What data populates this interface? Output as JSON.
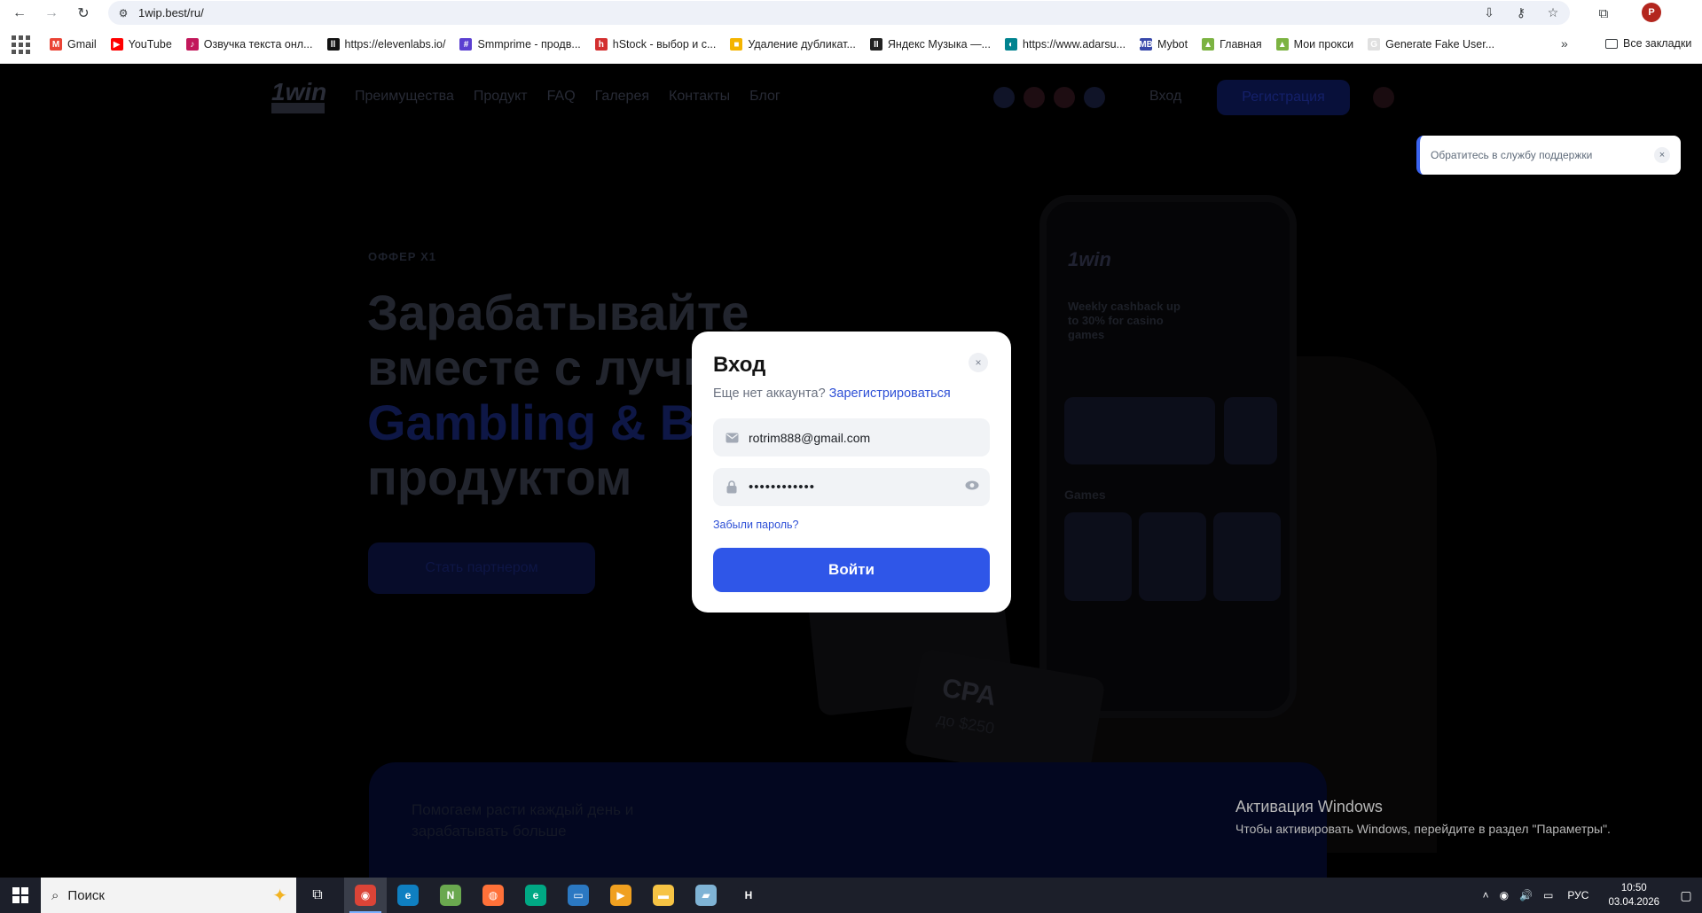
{
  "browser": {
    "url": "1wip.best/ru/",
    "profile_initial": "P",
    "bookmarks": [
      {
        "label": "Gmail",
        "color": "#ea4335",
        "glyph": "M"
      },
      {
        "label": "YouTube",
        "color": "#ff0000",
        "glyph": "▶"
      },
      {
        "label": "Озвучка текста онл...",
        "color": "#c2185b",
        "glyph": "♪"
      },
      {
        "label": "https://elevenlabs.io/",
        "color": "#111111",
        "glyph": "ll"
      },
      {
        "label": "Smmprime - продв...",
        "color": "#5b3fd1",
        "glyph": "#"
      },
      {
        "label": "hStock - выбор и с...",
        "color": "#d32f2f",
        "glyph": "h"
      },
      {
        "label": "Удаление дубликат...",
        "color": "#f4b400",
        "glyph": "■"
      },
      {
        "label": "Яндекс Музыка —...",
        "color": "#222222",
        "glyph": "II"
      },
      {
        "label": "https://www.adarsu...",
        "color": "#00838f",
        "glyph": "◐"
      },
      {
        "label": "Mybot",
        "color": "#3949ab",
        "glyph": "MB"
      },
      {
        "label": "Главная",
        "color": "#7cb342",
        "glyph": "▲"
      },
      {
        "label": "Мои прокси",
        "color": "#7cb342",
        "glyph": "▲"
      },
      {
        "label": "Generate Fake User...",
        "color": "#e0e0e0",
        "glyph": "G"
      }
    ],
    "more_bookmarks": "»",
    "all_bookmarks": "Все закладки"
  },
  "site": {
    "logo": "1win",
    "nav": [
      "Преимущества",
      "Продукт",
      "FAQ",
      "Галерея",
      "Контакты",
      "Блог"
    ],
    "login": "Вход",
    "register": "Регистрация",
    "hero_tag": "ОФФЕР X1",
    "hero_line1": "Зарабатывайте",
    "hero_line2": "вместе с лучш",
    "hero_line3": "Gambling & Be",
    "hero_line4": "продуктом",
    "hero_button": "Стать партнером",
    "phone_logo": "1win",
    "phone_promo": "Weekly cashback up to 30% for casino games",
    "phone_games": "Games",
    "cpa_title": "CPA",
    "cpa_sub": "до $250",
    "bottom_text": "Помогаем расти каждый день и зарабатывать больше"
  },
  "toast": {
    "text": "Обратитесь в службу поддержки",
    "close": "×"
  },
  "modal": {
    "title": "Вход",
    "close": "×",
    "no_account": "Еще нет аккаунта?",
    "register_link": "Зарегистрироваться",
    "email_value": "rotrim888@gmail.com",
    "password_value": "••••••••••••",
    "forgot": "Забыли пароль?",
    "submit": "Войти"
  },
  "watermark": {
    "title": "Активация Windows",
    "text": "Чтобы активировать Windows, перейдите в раздел \"Параметры\"."
  },
  "taskbar": {
    "search_placeholder": "Поиск",
    "lang": "РУС",
    "time": "10:50",
    "date": "03.04.2026",
    "apps": [
      {
        "name": "chrome",
        "color": "#db4437",
        "glyph": "◉",
        "active": true
      },
      {
        "name": "edge",
        "color": "#0f7fc1",
        "glyph": "e",
        "active": false
      },
      {
        "name": "notepad-plus",
        "color": "#6aa84f",
        "glyph": "N",
        "active": false
      },
      {
        "name": "firefox",
        "color": "#ff7139",
        "glyph": "◍",
        "active": false
      },
      {
        "name": "app-e",
        "color": "#00a884",
        "glyph": "e",
        "active": false
      },
      {
        "name": "remote-desktop",
        "color": "#2b78c2",
        "glyph": "▭",
        "active": false
      },
      {
        "name": "media-player",
        "color": "#f0a020",
        "glyph": "▶",
        "active": false
      },
      {
        "name": "file-explorer",
        "color": "#f6c344",
        "glyph": "▬",
        "active": false
      },
      {
        "name": "app-doc",
        "color": "#7fb3d5",
        "glyph": "▰",
        "active": false
      },
      {
        "name": "app-h",
        "color": "#1c1f2a",
        "glyph": "H",
        "active": false
      }
    ]
  }
}
